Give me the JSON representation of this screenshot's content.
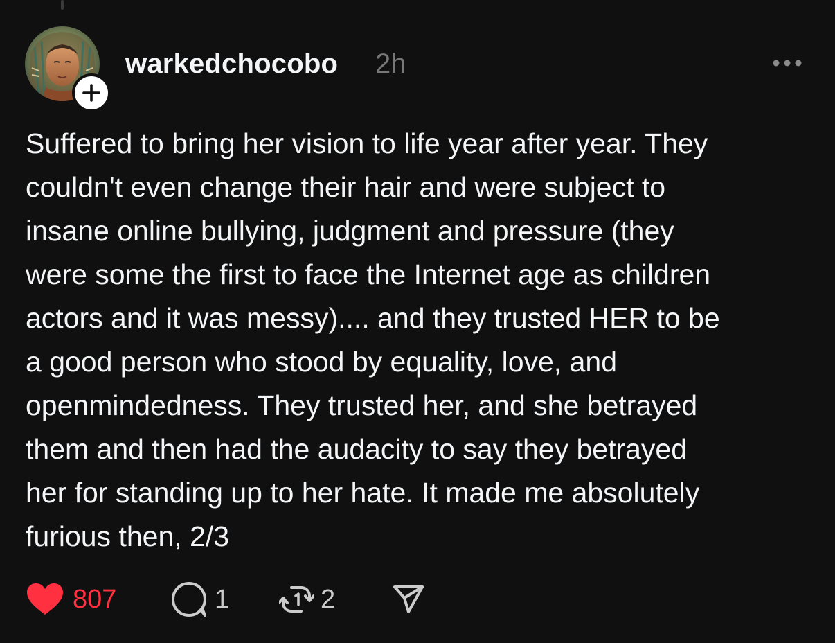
{
  "post": {
    "username": "warkedchocobo",
    "timestamp": "2h",
    "body_lines": [
      "Suffered to bring her vision to life year after year. They",
      "couldn't even change their hair and were subject to",
      "insane online bullying, judgment and pressure (they",
      "were some the first to face the Internet age as children",
      "actors and it was messy).... and they trusted HER to be",
      "a good person who stood by equality, love, and",
      "openmindedness. They trusted her, and she betrayed",
      "them and then had the audacity to say they betrayed",
      "her for standing up to her hate. It made me absolutely",
      "furious then, 2/3"
    ]
  },
  "actions": {
    "like_count": "807",
    "reply_count": "1",
    "repost_count": "2"
  },
  "icons": {
    "like": "heart-icon",
    "reply": "comment-bubble-icon",
    "repost": "repost-arrows-icon",
    "share": "send-paper-plane-icon",
    "more": "more-dots-icon",
    "follow": "plus-icon"
  },
  "colors": {
    "background": "#101010",
    "text_primary": "#f3f5f7",
    "text_secondary": "#777777",
    "like_red": "#ff3040"
  }
}
